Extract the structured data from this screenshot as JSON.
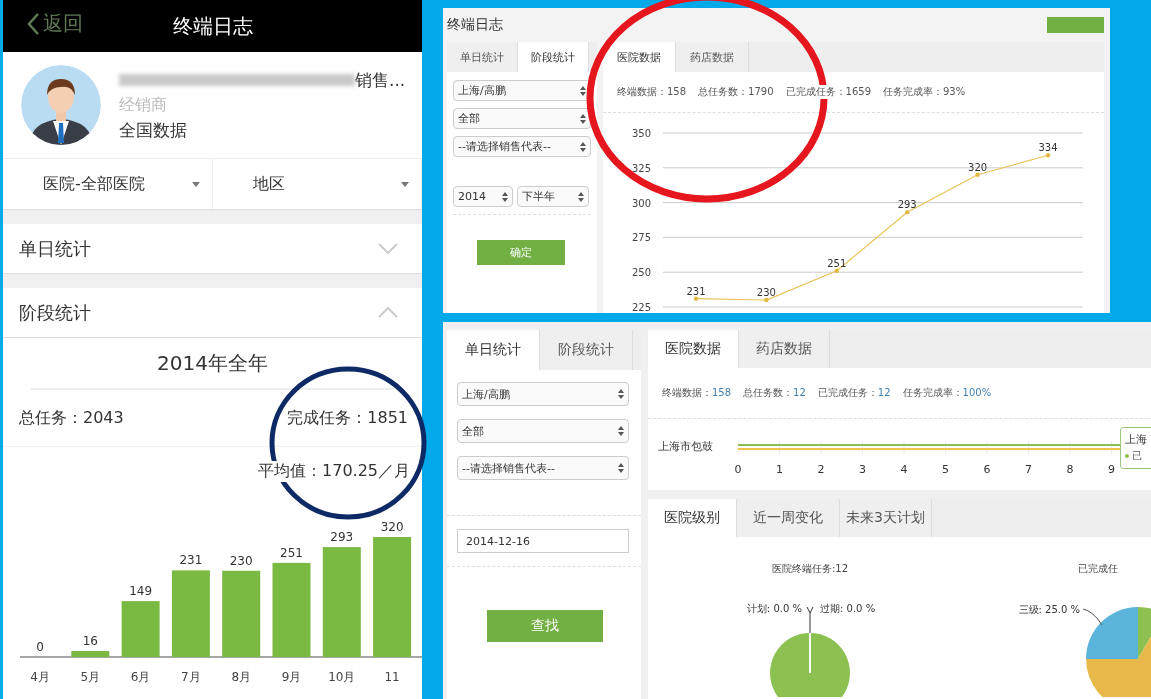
{
  "phone": {
    "back": "返回",
    "title": "终端日志",
    "profile": {
      "name_suffix": "销售...",
      "role": "经销商",
      "scope": "全国数据"
    },
    "filters": [
      {
        "label": "医院-全部医院"
      },
      {
        "label": "地区"
      }
    ],
    "sections": [
      {
        "label": "单日统计",
        "expanded": false
      },
      {
        "label": "阶段统计",
        "expanded": true
      }
    ],
    "period": "2014年全年",
    "total": "总任务：2043",
    "done": "完成任务：1851",
    "average": "平均值：170.25／月",
    "chart_data": {
      "type": "bar",
      "categories": [
        "4月",
        "5月",
        "6月",
        "7月",
        "8月",
        "9月",
        "10月",
        "11"
      ],
      "values": [
        0,
        16,
        149,
        231,
        230,
        251,
        293,
        320
      ],
      "data_labels": true
    }
  },
  "upper": {
    "title": "终端日志",
    "side_tabs": [
      {
        "label": "单日统计",
        "selected": false
      },
      {
        "label": "阶段统计",
        "selected": true
      }
    ],
    "selects": [
      "上海/高鹏",
      "全部",
      "--请选择销售代表--"
    ],
    "year": "2014",
    "half": "下半年",
    "submit": "确定",
    "data_tabs": [
      {
        "label": "医院数据",
        "selected": true
      },
      {
        "label": "药店数据",
        "selected": false
      }
    ],
    "stats": [
      {
        "label": "终端数据：",
        "value": "158"
      },
      {
        "label": "总任务数：",
        "value": "1790"
      },
      {
        "label": "已完成任务：",
        "value": "1659"
      },
      {
        "label": "任务完成率：",
        "value": "93%"
      }
    ],
    "chart_data": {
      "type": "line",
      "values": [
        231,
        230,
        251,
        293,
        320,
        334
      ],
      "ylim": [
        225,
        350
      ],
      "yticks": [
        225,
        250,
        275,
        300,
        325,
        350
      ],
      "grid": true,
      "data_labels": true
    }
  },
  "lower": {
    "side_tabs": [
      {
        "label": "单日统计",
        "selected": true
      },
      {
        "label": "阶段统计",
        "selected": false
      }
    ],
    "selects": [
      "上海/高鹏",
      "全部",
      "--请选择销售代表--"
    ],
    "date": "2014-12-16",
    "submit": "查找",
    "data_tabs": [
      {
        "label": "医院数据",
        "selected": true
      },
      {
        "label": "药店数据",
        "selected": false
      }
    ],
    "stats": [
      {
        "label": "终端数据：",
        "value": "158"
      },
      {
        "label": "总任务数：",
        "value": "12"
      },
      {
        "label": "已完成任务：",
        "value": "12"
      },
      {
        "label": "任务完成率：",
        "value": "100%"
      }
    ],
    "bar_chart": {
      "category": "上海市包鼓",
      "series": [
        {
          "color": "#8cc152"
        },
        {
          "color": "#f2c14e"
        }
      ],
      "ticks": [
        "0",
        "1",
        "2",
        "3",
        "4",
        "5",
        "6",
        "7",
        "8",
        "9"
      ],
      "tooltip": {
        "title": "上海",
        "line": "已",
        "color": "#8cc152"
      }
    },
    "level_tabs": [
      {
        "label": "医院级别",
        "selected": true
      },
      {
        "label": "近一周变化",
        "selected": false
      },
      {
        "label": "未来3天计划",
        "selected": false
      }
    ],
    "pies": [
      {
        "chart_data": {
          "type": "pie",
          "title": "医院终端任务:12",
          "values": [
            0,
            0,
            100
          ],
          "colors": [
            "#ffffff",
            "#ffffff",
            "#8cc152"
          ],
          "annotations": [
            "计划: 0.0 %",
            "过期: 0.0 %"
          ]
        }
      },
      {
        "chart_data": {
          "type": "pie",
          "title": "已完成任",
          "values": [
            25,
            8.3,
            66.7
          ],
          "colors": [
            "#5ab4dc",
            "#8cc152",
            "#e8b84a"
          ],
          "annotations": [
            "三级: 25.0 %"
          ]
        }
      }
    ]
  },
  "highlights": [
    {
      "color": "#e5161e"
    },
    {
      "color": "#0d2a66"
    }
  ]
}
